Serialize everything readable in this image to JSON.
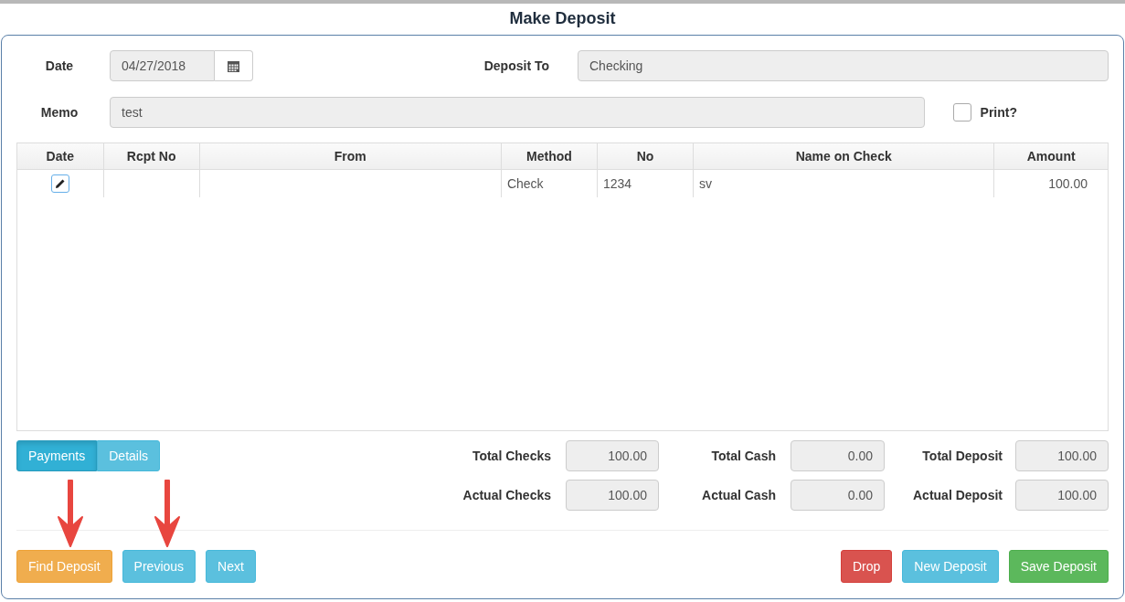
{
  "title": "Make Deposit",
  "form": {
    "date": {
      "label": "Date",
      "value": "04/27/2018"
    },
    "deposit_to": {
      "label": "Deposit To",
      "value": "Checking"
    },
    "memo": {
      "label": "Memo",
      "value": "test"
    },
    "print": {
      "label": "Print?",
      "checked": false
    }
  },
  "table": {
    "columns": [
      "Date",
      "Rcpt No",
      "From",
      "Method",
      "No",
      "Name on Check",
      "Amount"
    ],
    "rows": [
      {
        "editable": true,
        "method": "Check",
        "no": "1234",
        "name_on_check": "sv",
        "amount": "100.00"
      }
    ]
  },
  "tabs": [
    {
      "label": "Payments",
      "selected": true
    },
    {
      "label": "Details",
      "selected": false
    }
  ],
  "totals": [
    {
      "label": "Total Checks",
      "value": "100.00"
    },
    {
      "label": "Total Cash",
      "value": "0.00"
    },
    {
      "label": "Total Deposit",
      "value": "100.00"
    },
    {
      "label": "Actual Checks",
      "value": "100.00"
    },
    {
      "label": "Actual Cash",
      "value": "0.00"
    },
    {
      "label": "Actual Deposit",
      "value": "100.00"
    }
  ],
  "buttons_left": [
    {
      "label": "Find Deposit",
      "kind": "warning"
    },
    {
      "label": "Previous",
      "kind": "info"
    },
    {
      "label": "Next",
      "kind": "info"
    }
  ],
  "buttons_right": [
    {
      "label": "Drop",
      "kind": "danger"
    },
    {
      "label": "New Deposit",
      "kind": "info"
    },
    {
      "label": "Save Deposit",
      "kind": "success"
    }
  ]
}
